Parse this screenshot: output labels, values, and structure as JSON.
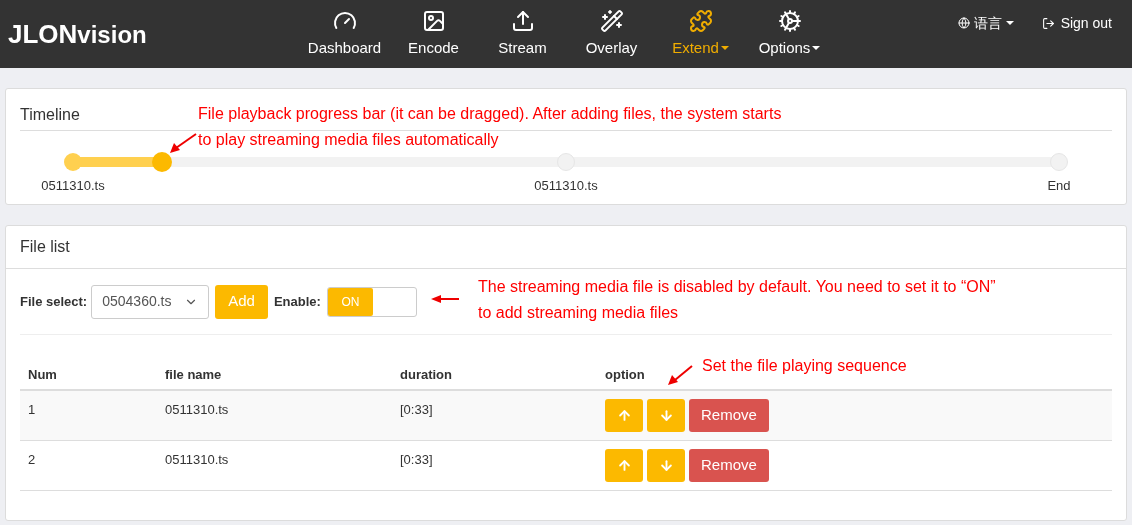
{
  "navbar": {
    "brand": {
      "main": "JLON",
      "suffix": "vision"
    },
    "items": [
      {
        "label": "Dashboard",
        "selected": false,
        "dropdown": false
      },
      {
        "label": "Encode",
        "selected": false,
        "dropdown": false
      },
      {
        "label": "Stream",
        "selected": false,
        "dropdown": false
      },
      {
        "label": "Overlay",
        "selected": false,
        "dropdown": false
      },
      {
        "label": "Extend",
        "selected": true,
        "dropdown": true
      },
      {
        "label": "Options",
        "selected": false,
        "dropdown": true
      }
    ],
    "language": "语言",
    "sign_out": "Sign out"
  },
  "timeline": {
    "title": "Timeline",
    "level": 0.09,
    "markers": [
      {
        "label": "0511310.ts"
      },
      {
        "label": "0511310.ts"
      },
      {
        "label": "End"
      }
    ],
    "annotation": {
      "lines": [
        "File playback progress bar (it can be dragged). After adding files, the system starts",
        "to play streaming media files automatically"
      ]
    }
  },
  "file_list": {
    "title": "File list",
    "file_select": {
      "label": "File select:",
      "value": "0504360.ts"
    },
    "add_button": "Add",
    "enable": {
      "label": "Enable:",
      "on": true,
      "on_text": "ON"
    },
    "enable_annotation": {
      "lines": [
        "The streaming media file is disabled by default. You need to set it to “ON”",
        "to add streaming media files"
      ]
    },
    "order_annotation": {
      "lines": [
        "Set the file playing sequence"
      ]
    },
    "table": {
      "columns": [
        "Num",
        "file name",
        "duration",
        "option"
      ],
      "rows": [
        {
          "num": "1",
          "file_name": "0511310.ts",
          "duration": "[0:33]",
          "remove": "Remove"
        },
        {
          "num": "2",
          "file_name": "0511310.ts",
          "duration": "[0:33]",
          "remove": "Remove"
        }
      ]
    }
  }
}
